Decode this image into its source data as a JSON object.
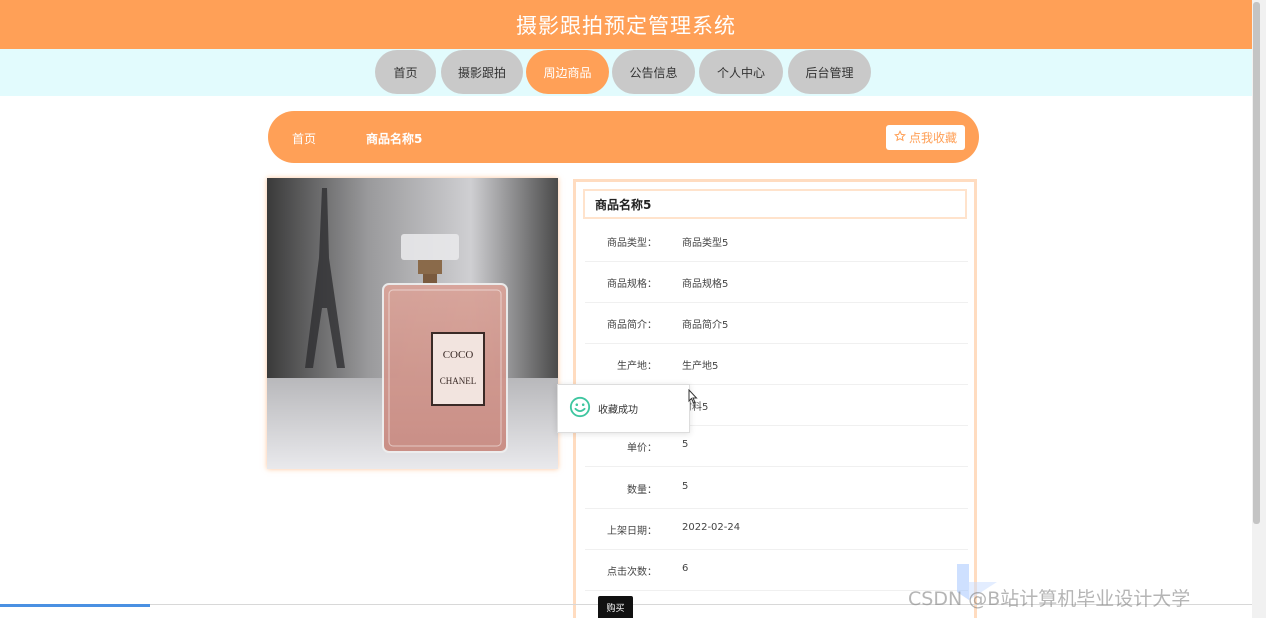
{
  "header": {
    "title": "摄影跟拍预定管理系统"
  },
  "nav": {
    "items": [
      {
        "label": "首页"
      },
      {
        "label": "摄影跟拍"
      },
      {
        "label": "周边商品",
        "active": true
      },
      {
        "label": "公告信息"
      },
      {
        "label": "个人中心"
      },
      {
        "label": "后台管理"
      }
    ]
  },
  "breadcrumb": {
    "home": "首页",
    "current": "商品名称5"
  },
  "favorite_button": {
    "label": "点我收藏",
    "icon": "star-outline-icon"
  },
  "product": {
    "name": "商品名称5",
    "image_label": {
      "brand_top": "COCO",
      "brand_bottom": "CHANEL"
    },
    "fields": [
      {
        "label": "商品类型：",
        "value": "商品类型5"
      },
      {
        "label": "商品规格：",
        "value": "商品规格5"
      },
      {
        "label": "商品简介：",
        "value": "商品简介5"
      },
      {
        "label": "生产地：",
        "value": "生产地5"
      },
      {
        "label": "",
        "value": "材料5"
      },
      {
        "label": "单价：",
        "value": "5"
      },
      {
        "label": "数量：",
        "value": "5"
      },
      {
        "label": "上架日期：",
        "value": "2022-02-24"
      },
      {
        "label": "点击次数：",
        "value": "6"
      }
    ]
  },
  "toast": {
    "message": "收藏成功",
    "icon": "smile-icon"
  },
  "buy_button": {
    "label": "购买"
  },
  "watermark": {
    "text": "CSDN @B站计算机毕业设计大学"
  },
  "colors": {
    "accent": "#ffa057",
    "nav_bg": "#e2fbfd",
    "inactive_tab": "#c9c9c9",
    "success": "#3fc6a0"
  }
}
